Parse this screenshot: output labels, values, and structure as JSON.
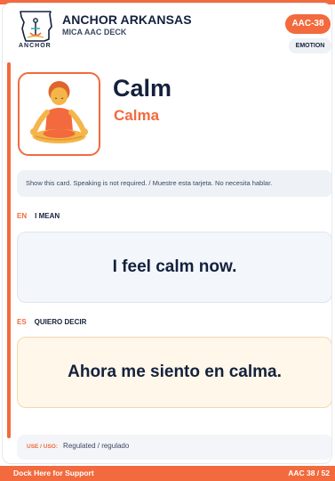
{
  "header": {
    "org_name": "ANCHOR ARKANSAS",
    "deck_name": "MICA AAC DECK",
    "logo_text": "ANCHOR",
    "card_code": "AAC-38",
    "category": "EMOTION"
  },
  "card": {
    "title_en": "Calm",
    "title_es": "Calma",
    "image_icon": "person-in-lotus-position-icon",
    "notice": "Show this card. Speaking is not required. / Muestre esta tarjeta. No necesita hablar."
  },
  "english": {
    "code": "EN",
    "label": "I MEAN",
    "phrase": "I feel calm now."
  },
  "spanish": {
    "code": "ES",
    "label": "QUIERO DECIR",
    "phrase": "Ahora me siento en calma."
  },
  "usage": {
    "label": "USE / USO:",
    "value": "Regulated / regulado"
  },
  "footer": {
    "support_label": "Dock Here for Support",
    "progress": "AAC 38 / 52"
  },
  "colors": {
    "accent": "#f26a3d",
    "navy": "#14213d",
    "en_box": "#f3f7fb",
    "es_box": "#fff7e9"
  }
}
